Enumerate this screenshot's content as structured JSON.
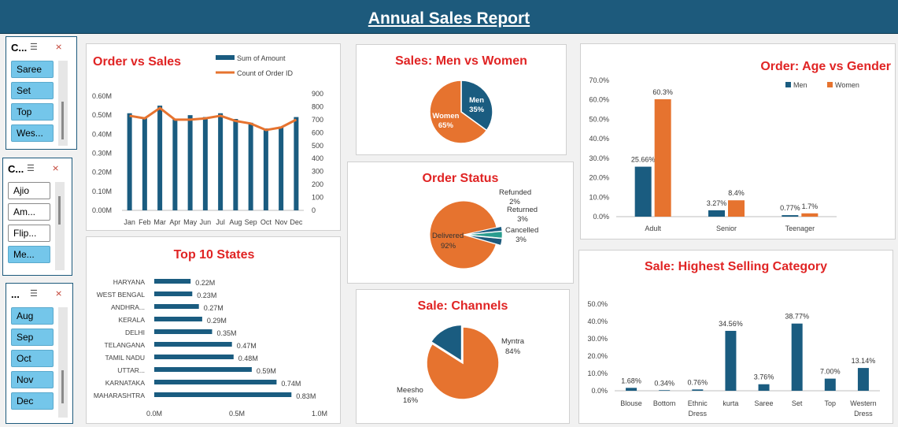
{
  "report": {
    "title": "Annual Sales Report"
  },
  "colors": {
    "banner": "#1d5a7c",
    "navy": "#1a5c80",
    "orange": "#e6732f",
    "title_red": "#e02424",
    "slicer_selected": "#74c6ea"
  },
  "slicers": [
    {
      "header": "C...",
      "items": [
        {
          "label": "Saree",
          "selected": true
        },
        {
          "label": "Set",
          "selected": true
        },
        {
          "label": "Top",
          "selected": true
        },
        {
          "label": "Wes...",
          "selected": true
        }
      ]
    },
    {
      "header": "C...",
      "items": [
        {
          "label": "Ajio",
          "selected": false
        },
        {
          "label": "Am...",
          "selected": false
        },
        {
          "label": "Flip...",
          "selected": false
        },
        {
          "label": "Me...",
          "selected": true
        }
      ]
    },
    {
      "header": "...",
      "items": [
        {
          "label": "Aug",
          "selected": true
        },
        {
          "label": "Sep",
          "selected": true
        },
        {
          "label": "Oct",
          "selected": true
        },
        {
          "label": "Nov",
          "selected": true
        },
        {
          "label": "Dec",
          "selected": true
        }
      ]
    }
  ],
  "chart_data": [
    {
      "id": "order_vs_sales",
      "type": "bar",
      "title": "Order vs Sales",
      "categories": [
        "Jan",
        "Feb",
        "Mar",
        "Apr",
        "May",
        "Jun",
        "Jul",
        "Aug",
        "Sep",
        "Oct",
        "Nov",
        "Dec"
      ],
      "series": [
        {
          "name": "Sum of Amount",
          "kind": "bar",
          "axis": "left",
          "values": [
            0.51,
            0.49,
            0.55,
            0.48,
            0.5,
            0.49,
            0.51,
            0.48,
            0.46,
            0.43,
            0.44,
            0.49
          ]
        },
        {
          "name": "Count of Order ID",
          "kind": "line",
          "axis": "right",
          "values": [
            730,
            710,
            790,
            700,
            700,
            710,
            730,
            690,
            670,
            620,
            640,
            700
          ]
        }
      ],
      "y_ticks_left": [
        "0.00M",
        "0.10M",
        "0.20M",
        "0.30M",
        "0.40M",
        "0.50M",
        "0.60M"
      ],
      "y_ticks_right": [
        "0",
        "100",
        "200",
        "300",
        "400",
        "500",
        "600",
        "700",
        "800",
        "900"
      ],
      "ylim_left": [
        0,
        0.6
      ],
      "ylim_right": [
        0,
        900
      ],
      "legend": "top-right"
    },
    {
      "id": "men_vs_women",
      "type": "pie",
      "title": "Sales: Men vs Women",
      "slices": [
        {
          "name": "Men",
          "value": 35,
          "label": "35%"
        },
        {
          "name": "Women",
          "value": 65,
          "label": "65%"
        }
      ]
    },
    {
      "id": "order_status",
      "type": "pie",
      "title": "Order Status",
      "slices": [
        {
          "name": "Delivered",
          "value": 92,
          "label": "92%"
        },
        {
          "name": "Refunded",
          "value": 2,
          "label": "2%"
        },
        {
          "name": "Returned",
          "value": 3,
          "label": "3%"
        },
        {
          "name": "Cancelled",
          "value": 3,
          "label": "3%"
        }
      ]
    },
    {
      "id": "channels",
      "type": "pie",
      "title": "Sale: Channels",
      "slices": [
        {
          "name": "Myntra",
          "value": 84,
          "label": "84%"
        },
        {
          "name": "Meesho",
          "value": 16,
          "label": "16%"
        }
      ]
    },
    {
      "id": "age_vs_gender",
      "type": "bar",
      "title": "Order: Age vs Gender",
      "categories": [
        "Adult",
        "Senior",
        "Teenager"
      ],
      "series": [
        {
          "name": "Men",
          "values": [
            25.66,
            3.27,
            0.77
          ],
          "labels": [
            "25.66%",
            "3.27%",
            "0.77%"
          ]
        },
        {
          "name": "Women",
          "values": [
            60.3,
            8.4,
            1.7
          ],
          "labels": [
            "60.3%",
            "8.4%",
            "1.7%"
          ]
        }
      ],
      "y_ticks": [
        "0.0%",
        "10.0%",
        "20.0%",
        "30.0%",
        "40.0%",
        "50.0%",
        "60.0%",
        "70.0%"
      ],
      "ylim": [
        0,
        70
      ],
      "legend": "top-right"
    },
    {
      "id": "top_states",
      "type": "bar",
      "orientation": "horizontal",
      "title": "Top 10 States",
      "categories": [
        "HARYANA",
        "WEST BENGAL",
        "ANDHRA...",
        "KERALA",
        "DELHI",
        "TELANGANA",
        "TAMIL NADU",
        "UTTAR...",
        "KARNATAKA",
        "MAHARASHTRA"
      ],
      "values": [
        0.22,
        0.23,
        0.27,
        0.29,
        0.35,
        0.47,
        0.48,
        0.59,
        0.74,
        0.83
      ],
      "labels": [
        "0.22M",
        "0.23M",
        "0.27M",
        "0.29M",
        "0.35M",
        "0.47M",
        "0.48M",
        "0.59M",
        "0.74M",
        "0.83M"
      ],
      "x_ticks": [
        "0.0M",
        "0.5M",
        "1.0M"
      ],
      "xlim": [
        0,
        1.0
      ]
    },
    {
      "id": "category",
      "type": "bar",
      "title": "Sale: Highest Selling Category",
      "categories": [
        "Blouse",
        "Bottom",
        "Ethnic Dress",
        "kurta",
        "Saree",
        "Set",
        "Top",
        "Western Dress"
      ],
      "values": [
        1.68,
        0.34,
        0.76,
        34.56,
        3.76,
        38.77,
        7.0,
        13.14
      ],
      "labels": [
        "1.68%",
        "0.34%",
        "0.76%",
        "34.56%",
        "3.76%",
        "38.77%",
        "7.00%",
        "13.14%"
      ],
      "y_ticks": [
        "0.0%",
        "10.0%",
        "20.0%",
        "30.0%",
        "40.0%",
        "50.0%"
      ],
      "ylim": [
        0,
        50
      ]
    }
  ]
}
